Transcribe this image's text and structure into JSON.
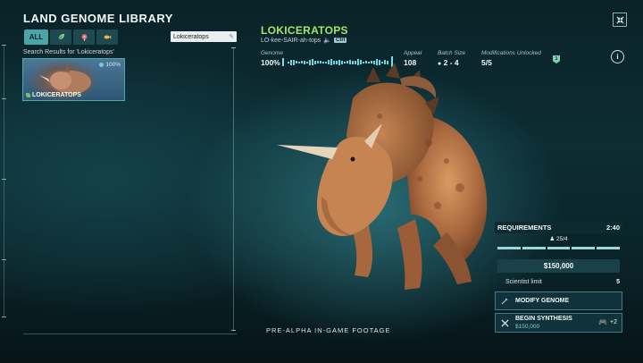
{
  "library": {
    "title": "LAND GENOME LIBRARY",
    "filters": [
      {
        "label": "ALL",
        "icon": "all",
        "active": true
      },
      {
        "label": "",
        "icon": "leaf-icon",
        "active": false
      },
      {
        "label": "",
        "icon": "meat-icon",
        "active": false
      },
      {
        "label": "",
        "icon": "fish-icon",
        "active": false
      }
    ],
    "search": {
      "value": "Lokiceratops",
      "placeholder": ""
    },
    "results_label": "Search Results for 'Lokiceratops'",
    "results": [
      {
        "name": "LOKICERATOPS",
        "percent": "100%"
      }
    ]
  },
  "species": {
    "name": "LOKICERATOPS",
    "phonetic": "LO-kee-SAIR-ah-tops",
    "audio_key": "Ctrl",
    "stats": [
      {
        "label": "Genome",
        "value": "100%"
      },
      {
        "label": "Appeal",
        "value": "108"
      },
      {
        "label": "Batch Size",
        "value": "2 - 4"
      },
      {
        "label": "Modifications Unlocked",
        "value": "5/5"
      }
    ],
    "genome_progress": 1.0
  },
  "footage_label": "PRE-ALPHA IN-GAME FOOTAGE",
  "requirements": {
    "title": "REQUIREMENTS",
    "time": "2:40",
    "scientists": "25/4",
    "cost": "$150,000",
    "scientist_limit_label": "Scientist limit",
    "scientist_limit_value": "5"
  },
  "actions": {
    "modify_label": "MODIFY GENOME",
    "synth_label": "BEGIN SYNTHESIS",
    "synth_cost": "$150,000",
    "synth_extra": "+2"
  },
  "colors": {
    "accent": "#9fe86a",
    "teal": "#4aa6a6"
  }
}
